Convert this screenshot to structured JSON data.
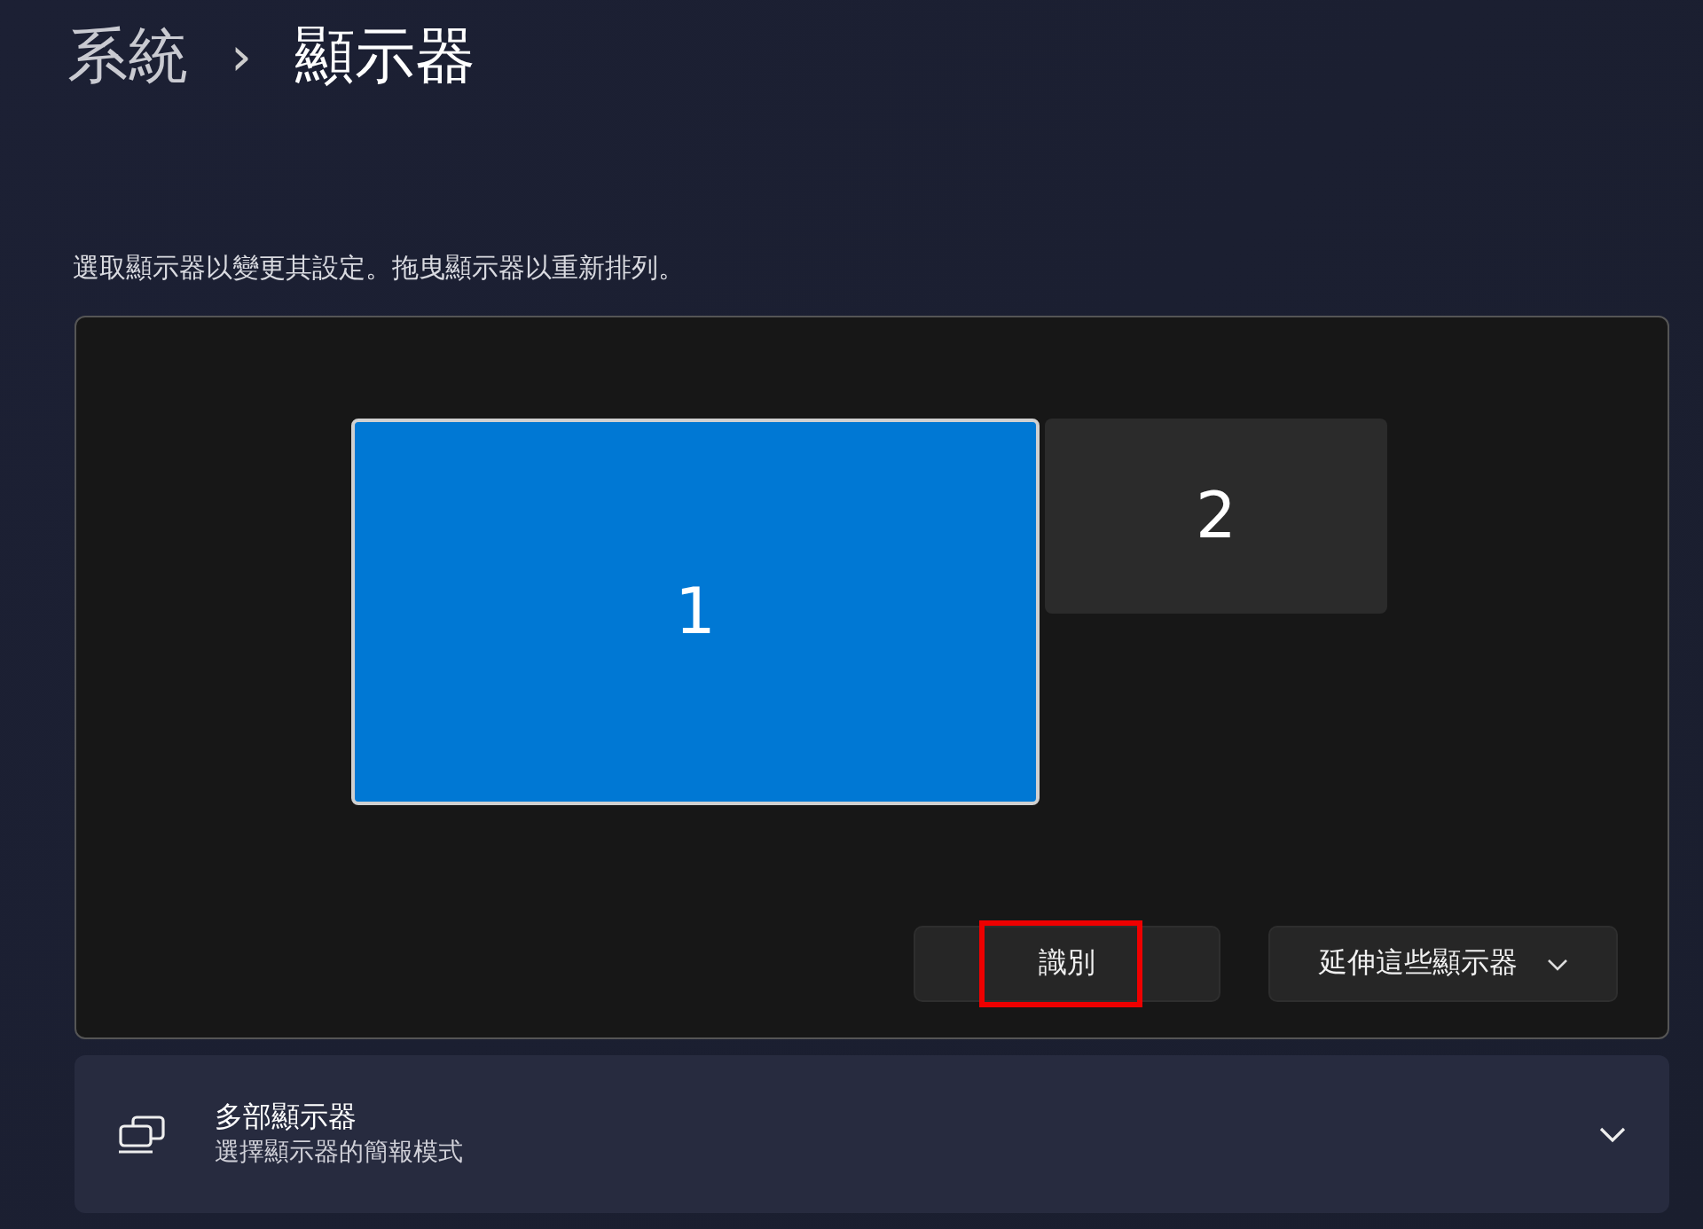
{
  "breadcrumb": {
    "parent": "系統",
    "separator": "›",
    "current": "顯示器"
  },
  "description": "選取顯示器以變更其設定。拖曳顯示器以重新排列。",
  "monitors": [
    {
      "label": "1",
      "selected": true
    },
    {
      "label": "2",
      "selected": false
    }
  ],
  "identify_button": {
    "label": "識別",
    "highlighted": true
  },
  "mode_dropdown": {
    "value": "延伸這些顯示器"
  },
  "multiple_displays": {
    "title": "多部顯示器",
    "subtitle": "選擇顯示器的簡報模式",
    "expanded": false
  }
}
